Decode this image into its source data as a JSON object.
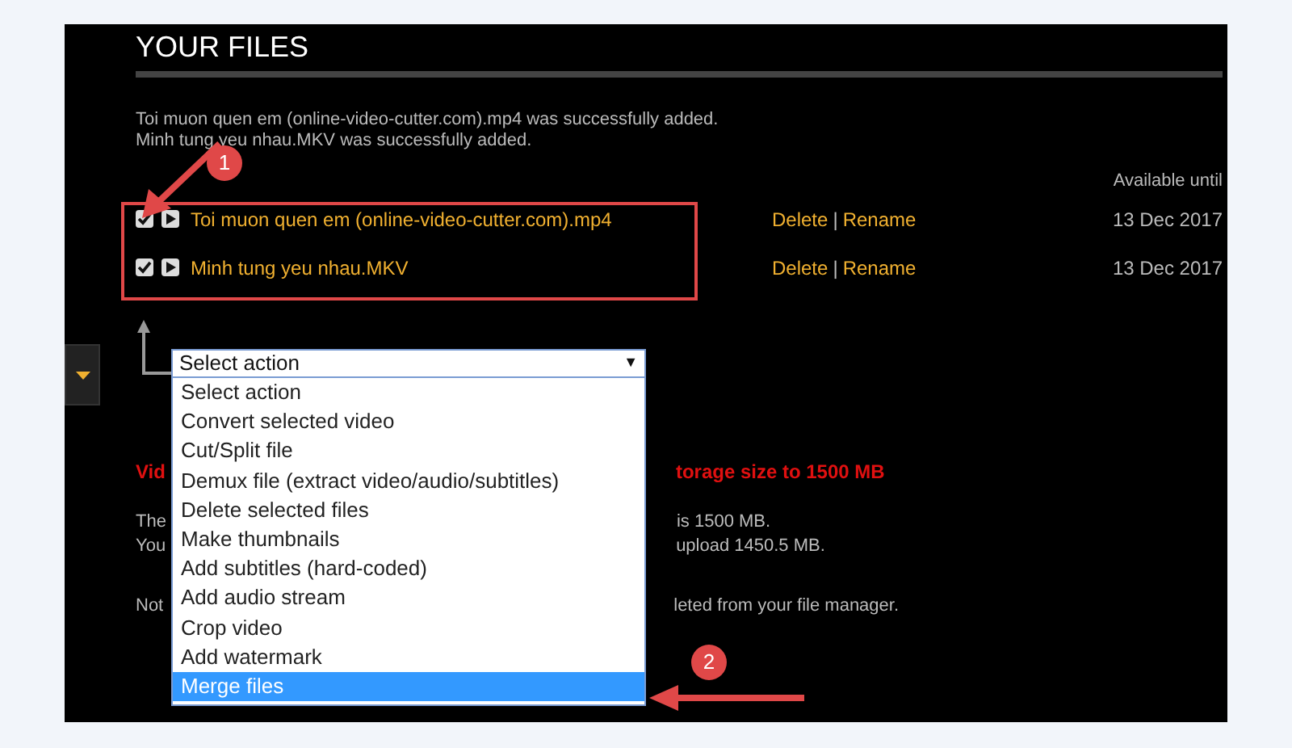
{
  "section_title": "YOUR FILES",
  "messages": [
    "Toi muon quen em (online-video-cutter.com).mp4 was successfully added.",
    "Minh tung yeu nhau.MKV was successfully added."
  ],
  "available_header": "Available until",
  "files": [
    {
      "name": "Toi muon quen em (online-video-cutter.com).mp4",
      "checked": true,
      "delete": "Delete",
      "separator": "|",
      "rename": "Rename",
      "date": "13 Dec 2017"
    },
    {
      "name": "Minh tung yeu nhau.MKV",
      "checked": true,
      "delete": "Delete",
      "separator": "|",
      "rename": "Rename",
      "date": "13 Dec 2017"
    }
  ],
  "action_select": {
    "value": "Select action",
    "arrow": "▼",
    "options": [
      {
        "label": "Select action",
        "highlighted": false
      },
      {
        "label": "Convert selected video",
        "highlighted": false
      },
      {
        "label": "Cut/Split file",
        "highlighted": false
      },
      {
        "label": "Demux file (extract video/audio/subtitles)",
        "highlighted": false
      },
      {
        "label": "Delete selected files",
        "highlighted": false
      },
      {
        "label": "Make thumbnails",
        "highlighted": false
      },
      {
        "label": "Add subtitles (hard-coded)",
        "highlighted": false
      },
      {
        "label": "Add audio stream",
        "highlighted": false
      },
      {
        "label": "Crop video",
        "highlighted": false
      },
      {
        "label": "Add watermark",
        "highlighted": false
      },
      {
        "label": "Merge files",
        "highlighted": true
      }
    ]
  },
  "hidden_lines": [
    {
      "kind": "warning",
      "left": "Vid",
      "right": "torage size to 1500 MB"
    },
    {
      "kind": "info",
      "left": "The",
      "right": "is 1500 MB."
    },
    {
      "kind": "info",
      "left": "You",
      "right": "upload 1450.5 MB."
    },
    {
      "kind": "gap"
    },
    {
      "kind": "info",
      "left": "Not",
      "right": "leted from your file manager."
    }
  ],
  "annotations": [
    {
      "number": "1"
    },
    {
      "number": "2"
    }
  ]
}
